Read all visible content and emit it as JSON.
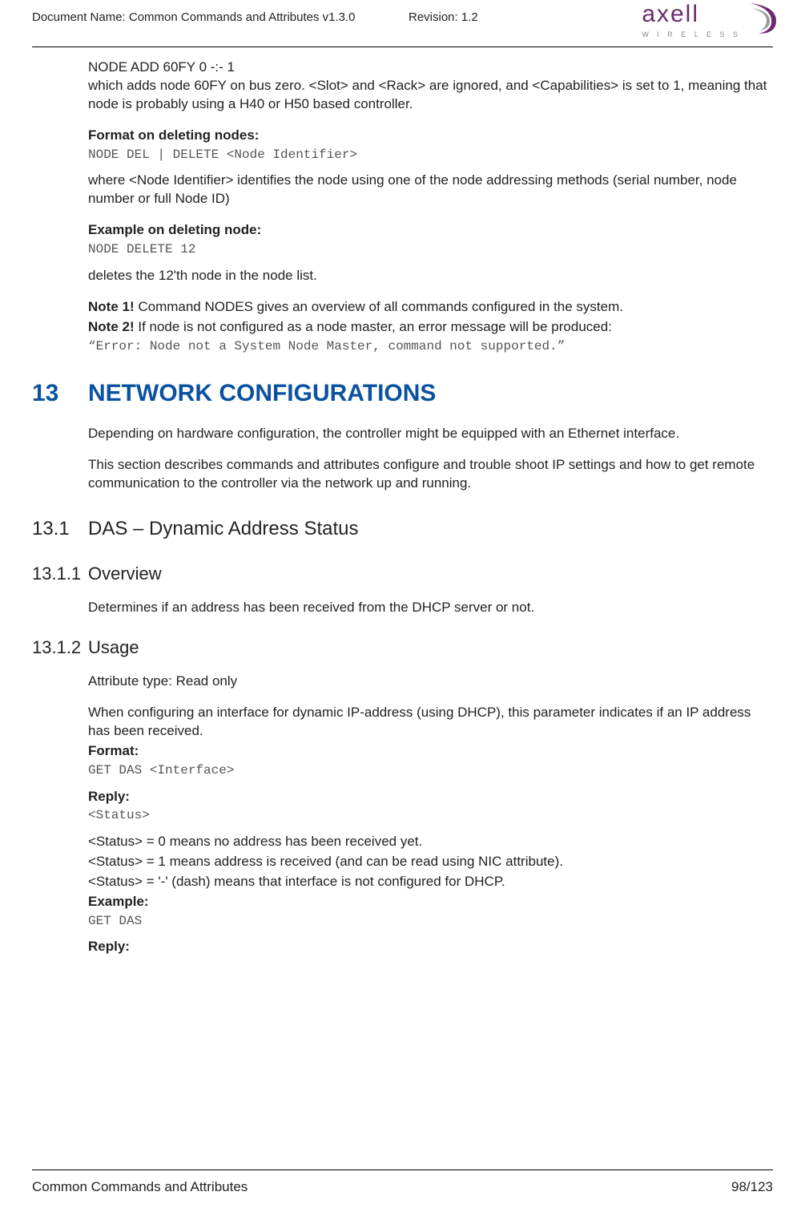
{
  "header": {
    "doc_label": "Document Name: Common Commands and Attributes v1.3.0",
    "revision": "Revision: 1.2",
    "logo_main": "axell",
    "logo_sub": "W I R E L E S S"
  },
  "body": {
    "p1_l1": "NODE ADD 60FY 0 -:- 1",
    "p1_l2": "which adds node 60FY on bus zero. <Slot> and <Rack> are ignored, and <Capabilities> is set to 1, meaning that node is probably using a H40 or H50 based controller.",
    "fmt_del_h": "Format on deleting nodes:",
    "fmt_del_code": "NODE DEL | DELETE <Node Identifier>",
    "fmt_del_desc": "where <Node Identifier> identifies the node using one of the node addressing methods (serial number, node number or full Node ID)",
    "ex_del_h": "Example on deleting node:",
    "ex_del_code": "NODE DELETE 12",
    "ex_del_desc": "deletes the 12'th node in the node list.",
    "note1_label": "Note 1!",
    "note1_text": " Command NODES gives an overview of all commands configured in the system.",
    "note2_label": "Note 2!",
    "note2_text": " If node is not configured as a node master, an error message will be produced:",
    "error_code": "“Error: Node not a System Node Master, command not supported.”",
    "s13_num": "13",
    "s13_title": "NETWORK CONFIGURATIONS",
    "s13_p1": "Depending on hardware configuration, the controller might be equipped with an Ethernet interface.",
    "s13_p2": "This section describes commands and attributes configure and trouble shoot IP settings and how to get remote communication to the controller via the network up and running.",
    "s131_num": "13.1",
    "s131_title": "DAS – Dynamic Address Status",
    "s1311_num": "13.1.1",
    "s1311_title": "Overview",
    "s1311_p": "Determines if an address has been received from the DHCP server or not.",
    "s1312_num": "13.1.2",
    "s1312_title": "Usage",
    "attr_type": "Attribute type: Read only",
    "usage_p": "When configuring an interface for dynamic IP-address (using DHCP), this parameter indicates if an IP address has been received.",
    "format_h": "Format:",
    "format_code": "GET DAS <Interface>",
    "reply_h": "Reply:",
    "reply_code": "<Status>",
    "status0": "<Status> = 0 means no address has been received yet.",
    "status1": "<Status> = 1 means address is received (and can be read using NIC attribute).",
    "status_dash": "<Status> = '-' (dash) means that interface is not configured for DHCP.",
    "example_h": "Example:",
    "example_code": "GET DAS",
    "reply2_h": "Reply:"
  },
  "footer": {
    "left": "Common Commands and Attributes",
    "right": "98/123"
  }
}
